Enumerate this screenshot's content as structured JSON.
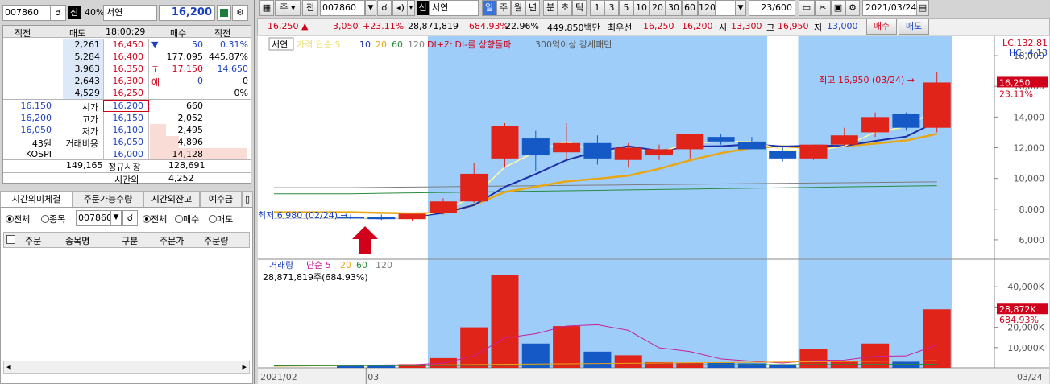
{
  "left": {
    "code": "007860",
    "shin": "신",
    "ratio": "40%",
    "name": "서연",
    "price": "16,200",
    "hdr": [
      "직전",
      "매도",
      "18:00:29",
      "매수",
      "직전"
    ],
    "asks": [
      {
        "qty": "2,261",
        "price": "16,450"
      },
      {
        "qty": "5,284",
        "price": "16,400"
      },
      {
        "qty": "3,963",
        "price": "16,350"
      },
      {
        "qty": "2,643",
        "price": "16,300"
      },
      {
        "qty": "4,529",
        "price": "16,250"
      }
    ],
    "ask_info": [
      {
        "a": "▼",
        "b": "50",
        "c": "0.31%"
      },
      {
        "a": "",
        "b": "177,095",
        "c": "445.87%"
      },
      {
        "a": "〒",
        "b": "17,150",
        "c": "14,650"
      },
      {
        "a": "예",
        "b": "0",
        "c": "0"
      },
      {
        "a": "",
        "b": "",
        "c": "0%"
      }
    ],
    "bid_info": [
      {
        "a": "16,150",
        "b": "시가"
      },
      {
        "a": "16,200",
        "b": "고가"
      },
      {
        "a": "16,050",
        "b": "저가"
      },
      {
        "a": "43원",
        "b": "거래비용"
      },
      {
        "a": "KOSPI",
        "b": ""
      }
    ],
    "bids": [
      {
        "price": "16,200",
        "qty": "660"
      },
      {
        "price": "16,150",
        "qty": "2,052"
      },
      {
        "price": "16,100",
        "qty": "2,495"
      },
      {
        "price": "16,050",
        "qty": "4,896"
      },
      {
        "price": "16,000",
        "qty": "14,128"
      }
    ],
    "total_left": "149,165",
    "regular_label": "정규시장",
    "regular_val": "128,691",
    "after_label": "시간외",
    "after_val": "4,252",
    "tabs": [
      "시간외미체결",
      "주문가능수량",
      "시간외잔고",
      "예수금"
    ],
    "filter": {
      "all": "전체",
      "stock": "종목",
      "code": "007860",
      "all2": "전체",
      "buy": "매수",
      "sell": "매도"
    },
    "cols": [
      "주문",
      "종목명",
      "구분",
      "주문가",
      "주문량"
    ]
  },
  "top": {
    "ju": "주",
    "jeon": "전",
    "code": "007860",
    "shin": "신",
    "name": "서연",
    "periods": [
      "일",
      "주",
      "월",
      "년",
      "분",
      "초",
      "틱"
    ],
    "nums": [
      "1",
      "3",
      "5",
      "10",
      "20",
      "30",
      "60",
      "120"
    ],
    "count": "23/600",
    "date": "2021/03/24"
  },
  "info": {
    "price": "16,250 ▲",
    "change": "3,050",
    "rate": "+23.11%",
    "vol": "28,871,819",
    "vol_pct": "684.93%",
    "turn": "22.96%",
    "amount": "449,850백만",
    "bid_lbl": "최우선",
    "bid1": "16,250",
    "bid2": "16,200",
    "open_lbl": "시",
    "open": "13,300",
    "high_lbl": "고",
    "high": "16,950",
    "low_lbl": "저",
    "low": "13,000",
    "buy": "매수",
    "sell": "매도"
  },
  "chart_data": {
    "type": "candlestick",
    "legend": {
      "name": "서연",
      "ma_label": "가격 단순 5",
      "ma": [
        "10",
        "20",
        "60",
        "120"
      ],
      "signal": "DI+가 DI-를 상향돌파",
      "pattern": "300억이상 강세패턴"
    },
    "ylim": [
      5000,
      19000
    ],
    "yticks": [
      "18,000",
      "16,000",
      "14,000",
      "12,000",
      "10,000",
      "8,000",
      "6,000"
    ],
    "x_labels": [
      "2021/02",
      "03",
      "03/24"
    ],
    "lc": "LC:132.81",
    "hc": "HC:-4.13",
    "last_price_tag": "16,250",
    "last_pct_tag": "23.11%",
    "high_note": "최고 16,950 (03/24) →",
    "low_note": "최저 6,980 (02/24) →",
    "candles": [
      {
        "o": 7500,
        "h": 7650,
        "l": 7350,
        "c": 7450
      },
      {
        "o": 7500,
        "h": 7650,
        "l": 7300,
        "c": 7350
      },
      {
        "o": 7350,
        "h": 7600,
        "l": 7200,
        "c": 7700
      },
      {
        "o": 7750,
        "h": 8700,
        "l": 7650,
        "c": 8500
      },
      {
        "o": 8500,
        "h": 11000,
        "l": 8400,
        "c": 10300
      },
      {
        "o": 11300,
        "h": 13600,
        "l": 10700,
        "c": 13400
      },
      {
        "o": 12600,
        "h": 13100,
        "l": 10500,
        "c": 11500
      },
      {
        "o": 11700,
        "h": 13600,
        "l": 11200,
        "c": 12300
      },
      {
        "o": 12300,
        "h": 12800,
        "l": 10900,
        "c": 11300
      },
      {
        "o": 11200,
        "h": 12300,
        "l": 10700,
        "c": 12000
      },
      {
        "o": 11500,
        "h": 12200,
        "l": 11200,
        "c": 11900
      },
      {
        "o": 11900,
        "h": 12500,
        "l": 11300,
        "c": 12900
      },
      {
        "o": 12700,
        "h": 12900,
        "l": 12200,
        "c": 12400
      },
      {
        "o": 12400,
        "h": 12700,
        "l": 12000,
        "c": 11900
      },
      {
        "o": 11800,
        "h": 12100,
        "l": 11100,
        "c": 11300
      },
      {
        "o": 11300,
        "h": 12100,
        "l": 11200,
        "c": 12200
      },
      {
        "o": 12200,
        "h": 13300,
        "l": 12100,
        "c": 12800
      },
      {
        "o": 13000,
        "h": 14300,
        "l": 12700,
        "c": 14000
      },
      {
        "o": 14200,
        "h": 14300,
        "l": 13100,
        "c": 13300
      },
      {
        "o": 13300,
        "h": 16950,
        "l": 13000,
        "c": 16250
      }
    ],
    "volume_legend": {
      "name": "거래량",
      "ma_label": "단순 5",
      "ma": [
        "20",
        "60",
        "120"
      ],
      "value": "28,871,819주(684.93%)"
    },
    "volume_yticks": [
      "40,000K",
      "30,000K",
      "20,000K",
      "10,000K"
    ],
    "volume_tag": "28,872K",
    "volume_pct_tag": "684.93%",
    "volume_ylim": [
      0,
      50000
    ],
    "volumes": [
      1200,
      1600,
      1800,
      4800,
      20000,
      45700,
      12000,
      20600,
      8000,
      6200,
      2800,
      2600,
      2500,
      2200,
      1800,
      9300,
      3300,
      12000,
      3000,
      28872
    ],
    "colors": {
      "up": "#e1241a",
      "down": "#1559c7",
      "shade": "#9ecdf9",
      "ma5": "#fff9a8",
      "ma10": "#1a2fa8",
      "ma20": "#e9a615",
      "ma60": "#2b8a3e",
      "ma120": "#7d7d7d",
      "vol_ma": "#c7209c"
    }
  }
}
